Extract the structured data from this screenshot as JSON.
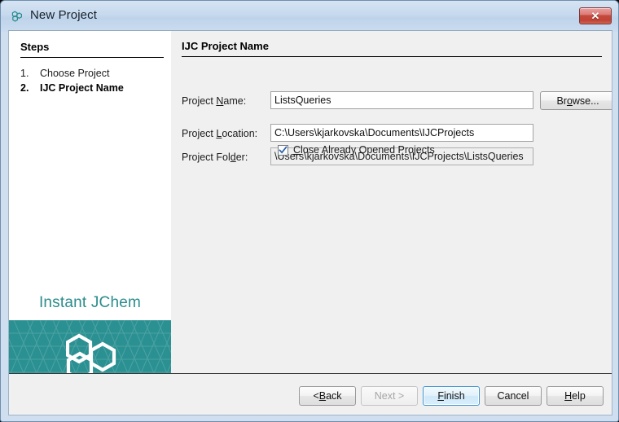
{
  "window": {
    "title": "New Project",
    "app_icon": "jchem-hexagon-icon",
    "close_label": "✕"
  },
  "sidebar": {
    "steps_heading": "Steps",
    "steps": [
      {
        "number": "1.",
        "label": "Choose Project",
        "active": false
      },
      {
        "number": "2.",
        "label": "IJC Project Name",
        "active": true
      }
    ],
    "brand_text": "Instant JChem",
    "brand_logo": "hexagon-cluster-logo",
    "brand_color": "#2a9092",
    "brand_text_color": "#2b8c8d"
  },
  "main": {
    "title": "IJC Project Name",
    "fields": [
      {
        "label_pre": "Project ",
        "label_mnemonic": "N",
        "label_post": "ame:",
        "value": "ListsQueries",
        "placeholder": "",
        "readonly": false
      },
      {
        "label_pre": "Project ",
        "label_mnemonic": "L",
        "label_post": "ocation:",
        "value": "C:\\Users\\kjarkovska\\Documents\\IJCProjects",
        "placeholder": "",
        "readonly": false
      },
      {
        "label_pre": "Project Fol",
        "label_mnemonic": "d",
        "label_post": "er:",
        "value": "\\Users\\kjarkovska\\Documents\\IJCProjects\\ListsQueries",
        "placeholder": "",
        "readonly": true
      }
    ],
    "browse_button": {
      "pre": "Br",
      "mnemonic": "o",
      "post": "wse..."
    },
    "checkbox": {
      "checked": true,
      "label_pre": "",
      "label_mnemonic": "C",
      "label_post": "lose Already Opened Projects"
    }
  },
  "buttonbar": {
    "buttons": [
      {
        "pre": "< ",
        "mnemonic": "B",
        "post": "ack",
        "state": "normal"
      },
      {
        "pre": "Next >",
        "mnemonic": "",
        "post": "",
        "state": "disabled"
      },
      {
        "pre": "",
        "mnemonic": "F",
        "post": "inish",
        "state": "default"
      },
      {
        "pre": "Cancel",
        "mnemonic": "",
        "post": "",
        "state": "normal"
      },
      {
        "pre": "",
        "mnemonic": "H",
        "post": "elp",
        "state": "normal"
      }
    ]
  },
  "colors": {
    "titlebar": "#c6d9ee",
    "close_red": "#c44b3f",
    "accent_blue": "#3c96d4",
    "teal": "#2a9092"
  }
}
